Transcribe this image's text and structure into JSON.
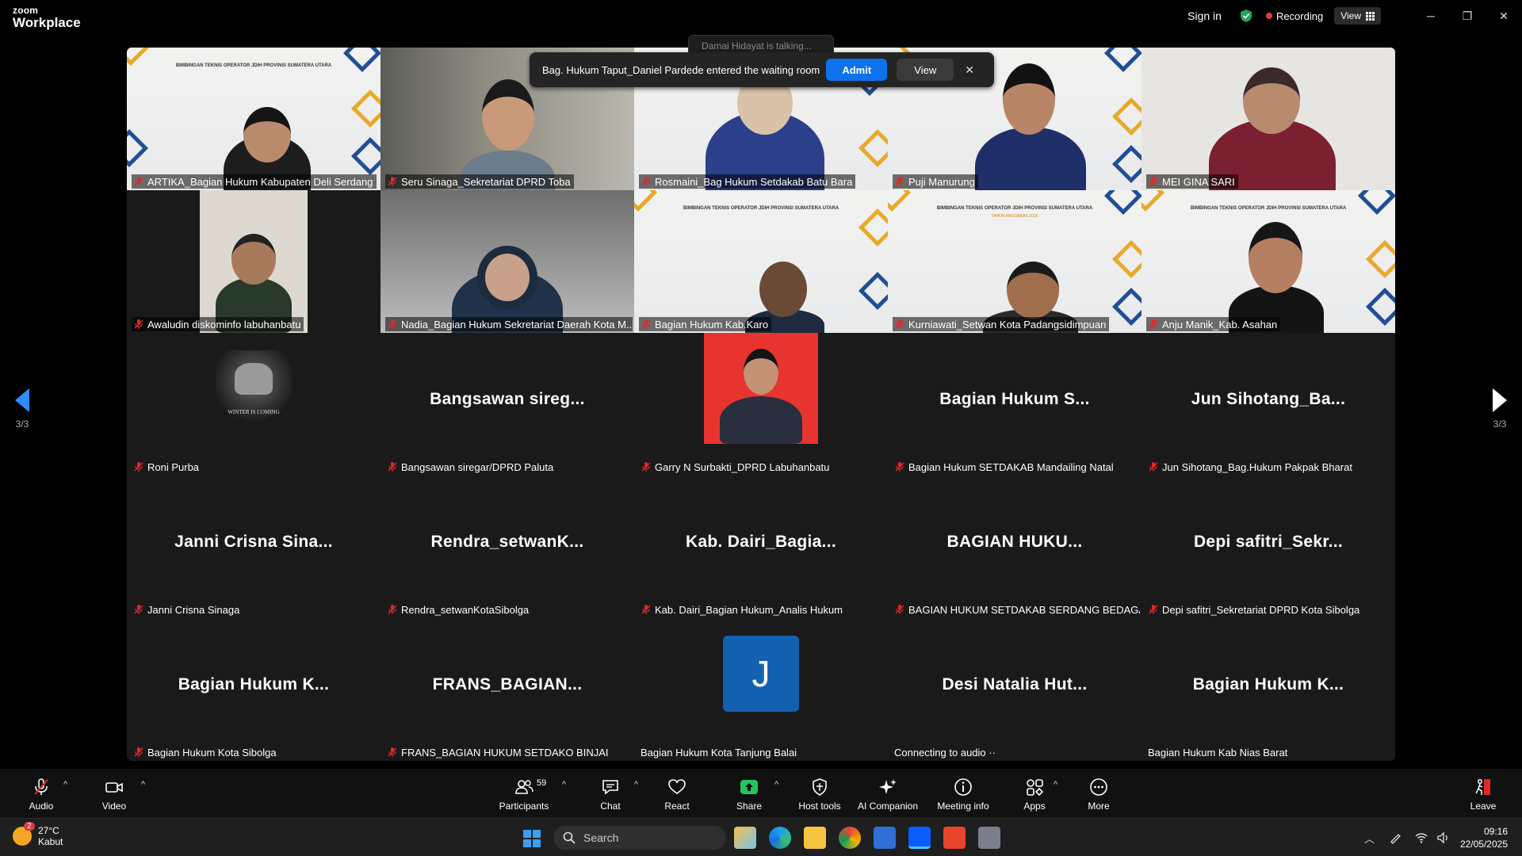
{
  "window": {
    "brand_top": "zoom",
    "brand_bottom": "Workplace",
    "sign_in": "Sign in",
    "recording": "Recording",
    "view": "View",
    "minimize": "─",
    "restore": "❐",
    "close": "✕"
  },
  "notification": {
    "talking": "Damai Hidayat is talking...",
    "message": "Bag. Hukum Taput_Daniel Pardede entered the waiting room",
    "admit": "Admit",
    "view": "View",
    "close": "✕"
  },
  "pagination": {
    "left": "3/3",
    "right": "3/3"
  },
  "tiles": [
    {
      "name": "ARTIKA_Bagian Hukum Kabupaten Deli Serdang",
      "muted": true
    },
    {
      "name": "Seru Sinaga_Sekretariat DPRD Toba",
      "muted": true
    },
    {
      "name": "Rosmaini_Bag Hukum Setdakab Batu Bara",
      "muted": true
    },
    {
      "name": "Puji Manurung",
      "muted": true
    },
    {
      "name": "MEI GINA SARI",
      "muted": true
    },
    {
      "name": "Awaludin diskominfo labuhanbatu",
      "muted": true
    },
    {
      "name": "Nadia_Bagian Hukum Sekretariat Daerah Kota M...",
      "muted": true
    },
    {
      "name": "Bagian Hukum Kab.Karo",
      "muted": true
    },
    {
      "name": "Kurniawati_Setwan Kota Padangsidimpuan",
      "muted": true
    },
    {
      "name": "Anju Manik_Kab. Asahan",
      "muted": true
    },
    {
      "name": "Roni Purba",
      "muted": true,
      "avatar_text": "WINTER IS COMING"
    },
    {
      "name": "Bangsawan siregar/DPRD Paluta",
      "muted": true,
      "display": "Bangsawan sireg..."
    },
    {
      "name": "Garry N Surbakti_DPRD Labuhanbatu",
      "muted": true
    },
    {
      "name": "Bagian Hukum SETDAKAB Mandailing Natal",
      "muted": true,
      "display": "Bagian Hukum S..."
    },
    {
      "name": "Jun Sihotang_Bag.Hukum Pakpak Bharat",
      "muted": true,
      "display": "Jun Sihotang_Ba..."
    },
    {
      "name": "Janni Crisna Sinaga",
      "muted": true,
      "display": "Janni Crisna Sina..."
    },
    {
      "name": "Rendra_setwanKotaSibolga",
      "muted": true,
      "display": "Rendra_setwanK..."
    },
    {
      "name": "Kab. Dairi_Bagian Hukum_Analis Hukum",
      "muted": true,
      "display": "Kab. Dairi_Bagia..."
    },
    {
      "name": "BAGIAN HUKUM SETDAKAB SERDANG BEDAGAI_...",
      "muted": true,
      "display": "BAGIAN HUKU..."
    },
    {
      "name": "Depi safitri_Sekretariat DPRD Kota Sibolga",
      "muted": true,
      "display": "Depi safitri_Sekr..."
    },
    {
      "name": "Bagian Hukum Kota Sibolga",
      "muted": true,
      "display": "Bagian Hukum K..."
    },
    {
      "name": "FRANS_BAGIAN HUKUM SETDAKO BINJAI",
      "muted": true,
      "display": "FRANS_BAGIAN..."
    },
    {
      "name": "Bagian Hukum Kota Tanjung Balai",
      "muted": false,
      "avatar_letter": "J"
    },
    {
      "name": "Connecting to audio ··",
      "muted": false,
      "display": "Desi Natalia Hut..."
    },
    {
      "name": "Bagian Hukum Kab Nias Barat",
      "muted": false,
      "display": "Bagian Hukum K..."
    }
  ],
  "toolbar": {
    "audio": "Audio",
    "video": "Video",
    "participants": "Participants",
    "participants_count": "59",
    "chat": "Chat",
    "react": "React",
    "share": "Share",
    "host_tools": "Host tools",
    "ai_companion": "AI Companion",
    "meeting_info": "Meeting info",
    "apps": "Apps",
    "more": "More",
    "leave": "Leave",
    "caret": "^"
  },
  "taskbar": {
    "weather_badge": "2",
    "temperature": "27°C",
    "condition": "Kabut",
    "search_placeholder": "Search",
    "time": "09:16",
    "date": "22/05/2025"
  },
  "colors": {
    "accent_blue": "#0e72ed",
    "recording_red": "#e5393d",
    "muted_red": "#e02828",
    "avatar_blue": "#1360b0"
  }
}
